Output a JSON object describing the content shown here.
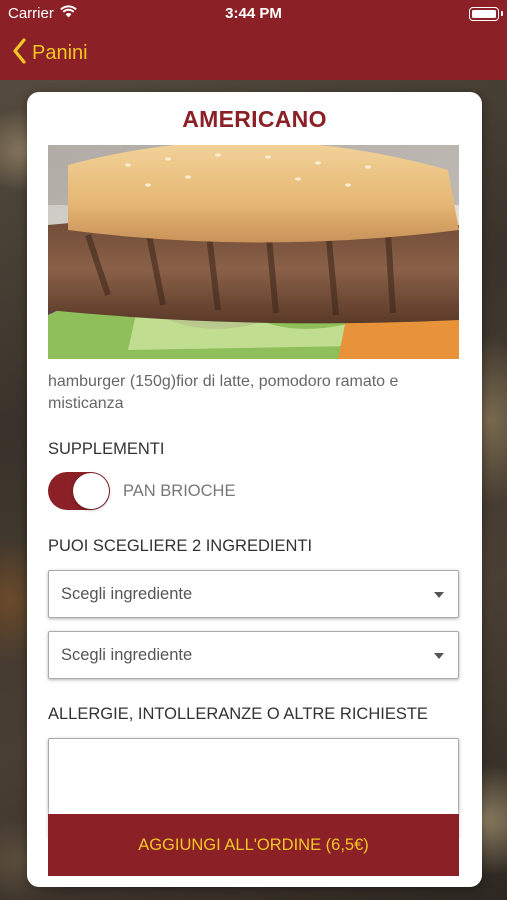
{
  "status_bar": {
    "carrier": "Carrier",
    "time": "3:44 PM"
  },
  "nav": {
    "back_label": "Panini"
  },
  "product": {
    "title": "AMERICANO",
    "description": "hamburger (150g)fior di latte, pomodoro ramato e misticanza"
  },
  "supplements": {
    "label": "SUPPLEMENTI",
    "option_label": "PAN BRIOCHE",
    "enabled": true
  },
  "ingredients": {
    "label": "PUOI SCEGLIERE 2 INGREDIENTI",
    "select_1": "Scegli ingrediente",
    "select_2": "Scegli ingrediente"
  },
  "requests": {
    "label": "ALLERGIE, INTOLLERANZE O ALTRE RICHIESTE",
    "value": ""
  },
  "order_button": {
    "label": "AGGIUNGI ALL'ORDINE (6,5€)"
  },
  "colors": {
    "brand": "#8b2027",
    "accent": "#f3c623"
  },
  "icons": {
    "back": "chevron-left-icon",
    "wifi": "wifi-icon",
    "battery": "battery-icon",
    "dropdown": "caret-down-icon"
  }
}
